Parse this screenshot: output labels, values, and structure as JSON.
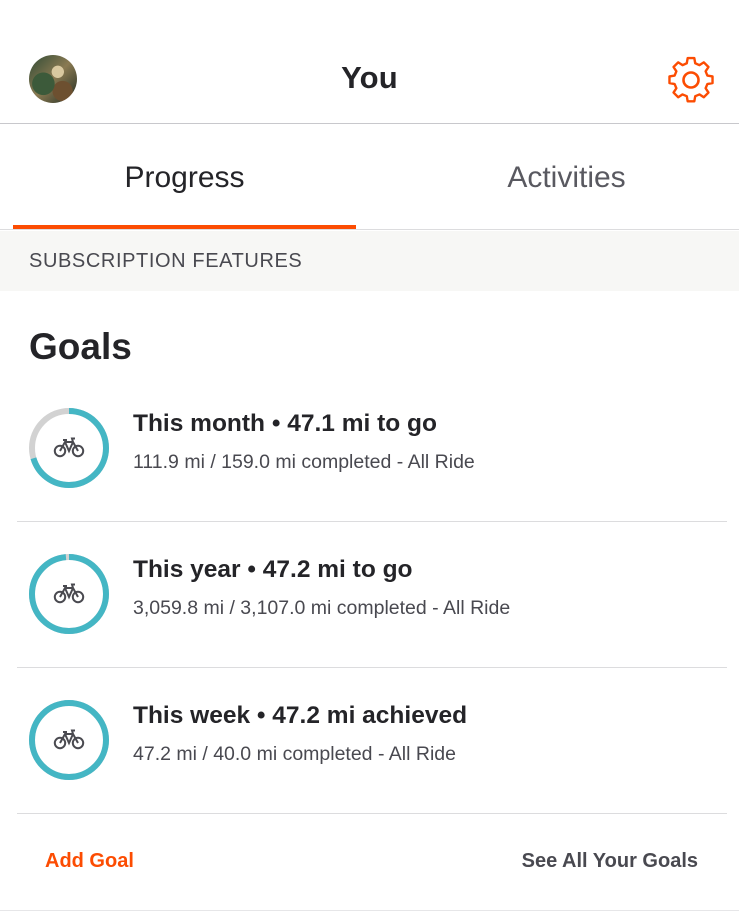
{
  "header": {
    "title": "You",
    "avatar": "user-avatar-photo",
    "settings_icon": "gear-icon"
  },
  "tabs": [
    {
      "label": "Progress",
      "active": true
    },
    {
      "label": "Activities",
      "active": false
    }
  ],
  "subscription": {
    "label": "SUBSCRIPTION FEATURES"
  },
  "goals": {
    "title": "Goals",
    "items": [
      {
        "heading": "This month • 47.1 mi to go",
        "detail": "111.9 mi / 159.0 mi completed - All Ride",
        "progress": 0.704,
        "icon": "bicycle-icon"
      },
      {
        "heading": "This year • 47.2 mi to go",
        "detail": "3,059.8 mi / 3,107.0 mi completed - All Ride",
        "progress": 0.985,
        "icon": "bicycle-icon"
      },
      {
        "heading": "This week • 47.2 mi achieved",
        "detail": "47.2 mi / 40.0 mi completed - All Ride",
        "progress": 1.0,
        "icon": "bicycle-icon"
      }
    ],
    "add_label": "Add Goal",
    "see_all_label": "See All Your Goals"
  },
  "colors": {
    "accent": "#fc4c02",
    "ring_progress": "#44b6c4",
    "ring_track": "#d2d2d2",
    "subscription_bg": "#f7f7f5"
  }
}
